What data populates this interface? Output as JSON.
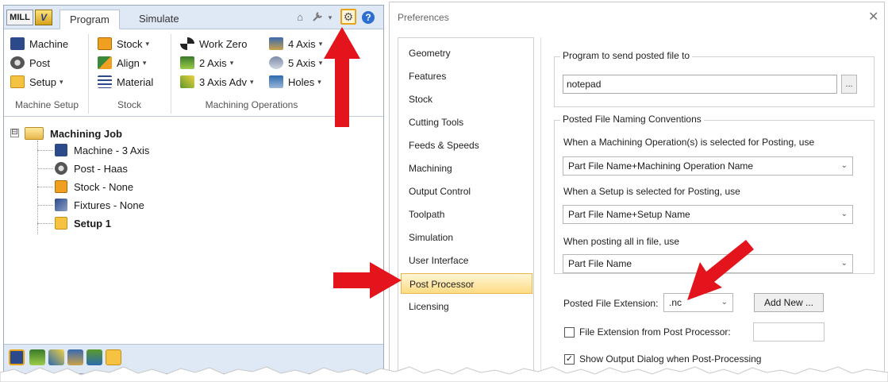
{
  "app": {
    "mode_button": "MILL",
    "tabs": [
      {
        "label": "Program",
        "active": true
      },
      {
        "label": "Simulate",
        "active": false
      }
    ],
    "toolbar_icons": [
      "home-icon",
      "wrench-icon",
      "gear-icon",
      "help-icon"
    ],
    "help_glyph": "?"
  },
  "ribbon": {
    "groups": [
      {
        "label": "Machine Setup",
        "items": [
          {
            "label": "Machine",
            "icon": "machine-icon",
            "color": "#2c4a8a"
          },
          {
            "label": "Post",
            "icon": "post-icon",
            "color": "#555555"
          },
          {
            "label": "Setup",
            "icon": "setup-icon",
            "color": "#e8a317",
            "dropdown": true
          }
        ]
      },
      {
        "label": "Stock",
        "items": [
          {
            "label": "Stock",
            "icon": "stock-icon",
            "color": "#f0a020",
            "dropdown": true
          },
          {
            "label": "Align",
            "icon": "align-icon",
            "color": "#3a8a3a",
            "dropdown": true
          },
          {
            "label": "Material",
            "icon": "material-icon",
            "color": "#2c4a8a"
          }
        ]
      },
      {
        "label": "Machining Operations",
        "items": [
          {
            "label": "Work Zero",
            "icon": "work-zero-icon",
            "color": "#222222"
          },
          {
            "label": "2 Axis",
            "icon": "2-axis-icon",
            "color": "#3a7a2a",
            "dropdown": true
          },
          {
            "label": "3 Axis Adv",
            "icon": "3-axis-adv-icon",
            "color": "#5a9a2a",
            "dropdown": true
          },
          {
            "label": "4 Axis",
            "icon": "4-axis-icon",
            "color": "#3a6ab0",
            "dropdown": true
          },
          {
            "label": "5 Axis",
            "icon": "5-axis-icon",
            "color": "#7a8aa8",
            "dropdown": true
          },
          {
            "label": "Holes",
            "icon": "holes-icon",
            "color": "#2c6ab0",
            "dropdown": true
          }
        ]
      }
    ],
    "dropdown_glyph": "▾"
  },
  "tree": {
    "root": {
      "label": "Machining Job",
      "icon": "folder-icon",
      "expander": "⊟"
    },
    "children": [
      {
        "label": "Machine - 3 Axis",
        "icon": "machine-icon",
        "bold": false
      },
      {
        "label": "Post - Haas",
        "icon": "post-icon",
        "bold": false
      },
      {
        "label": "Stock - None",
        "icon": "stock-icon",
        "bold": false
      },
      {
        "label": "Fixtures - None",
        "icon": "fixtures-icon",
        "bold": false
      },
      {
        "label": "Setup 1",
        "icon": "setup-icon",
        "bold": true
      }
    ]
  },
  "bottom_bar_icons": [
    "job-tree-icon",
    "ops-icon",
    "toolpath-icon",
    "tools-icon",
    "sim-icon",
    "setup-tab-icon"
  ],
  "dialog": {
    "title": "Preferences",
    "close_glyph": "✕",
    "categories": [
      "Geometry",
      "Features",
      "Stock",
      "Cutting Tools",
      "Feeds & Speeds",
      "Machining",
      "Output Control",
      "Toolpath",
      "Simulation",
      "User Interface",
      "Post Processor",
      "Licensing"
    ],
    "selected_category": "Post Processor",
    "program_group": {
      "legend": "Program to send posted file to",
      "value": "notepad",
      "browse_label": "..."
    },
    "naming_group": {
      "legend": "Posted File Naming Conventions",
      "op_label": "When a Machining Operation(s) is selected for Posting, use",
      "op_value": "Part File Name+Machining Operation Name",
      "setup_label": "When a Setup is selected for Posting, use",
      "setup_value": "Part File Name+Setup Name",
      "all_label": "When posting all in file, use",
      "all_value": "Part File Name"
    },
    "extension_label": "Posted File Extension:",
    "extension_value": ".nc",
    "add_new_label": "Add New ...",
    "ext_from_post_label": "File Extension from Post Processor:",
    "ext_from_post_checked": false,
    "ext_from_post_value": "",
    "show_output_label": "Show Output Dialog when Post-Processing",
    "show_output_checked": true,
    "check_glyph": "✓",
    "chevron_glyph": "⌄"
  },
  "colors": {
    "arrow": "#e3141b",
    "highlight": "#fddb83"
  }
}
